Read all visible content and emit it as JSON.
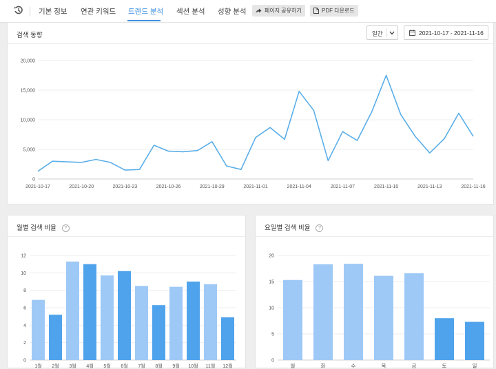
{
  "nav": {
    "tabs": [
      {
        "label": "기본 정보"
      },
      {
        "label": "연관 키워드"
      },
      {
        "label": "트렌드 분석"
      },
      {
        "label": "섹션 분석"
      },
      {
        "label": "성향 분석"
      }
    ],
    "share_label": "페이지 공유하기",
    "pdf_label": "PDF 다운로드",
    "history_icon": "history-icon",
    "accent_color": "#3d8fe0"
  },
  "trend": {
    "title": "검색 동향",
    "period_value": "일간",
    "date_range": "2021-10-17 - 2021-11-16"
  },
  "monthly": {
    "title": "월별 검색 비율"
  },
  "weekday": {
    "title": "요일별 검색 비율"
  },
  "chart_data": [
    {
      "type": "line",
      "x": [
        "2021-10-17",
        "2021-10-18",
        "2021-10-19",
        "2021-10-20",
        "2021-10-21",
        "2021-10-22",
        "2021-10-23",
        "2021-10-24",
        "2021-10-25",
        "2021-10-26",
        "2021-10-27",
        "2021-10-28",
        "2021-10-29",
        "2021-10-30",
        "2021-10-31",
        "2021-11-01",
        "2021-11-02",
        "2021-11-03",
        "2021-11-04",
        "2021-11-05",
        "2021-11-06",
        "2021-11-07",
        "2021-11-08",
        "2021-11-09",
        "2021-11-10",
        "2021-11-11",
        "2021-11-12",
        "2021-11-13",
        "2021-11-14",
        "2021-11-15",
        "2021-11-16"
      ],
      "x_ticks": [
        "2021-10-17",
        "2021-10-20",
        "2021-10-23",
        "2021-10-26",
        "2021-10-29",
        "2021-11-01",
        "2021-11-04",
        "2021-11-07",
        "2021-11-10",
        "2021-11-13",
        "2021-11-16"
      ],
      "values": [
        1300,
        3000,
        2900,
        2800,
        3300,
        2800,
        1500,
        1600,
        5700,
        4700,
        4600,
        4800,
        6300,
        2200,
        1600,
        7000,
        8700,
        6700,
        14800,
        11600,
        3100,
        8000,
        6500,
        11300,
        17500,
        10900,
        7200,
        4400,
        6800,
        11100,
        7200
      ],
      "ylim": [
        0,
        20000
      ],
      "yticks": [
        "0",
        "5,000",
        "10,000",
        "15,000",
        "20,000"
      ],
      "color": "#5aaee8",
      "grid": true
    },
    {
      "type": "bar",
      "categories": [
        "1월",
        "2월",
        "3월",
        "4월",
        "5월",
        "6월",
        "7월",
        "8월",
        "9월",
        "10월",
        "11월",
        "12월"
      ],
      "values": [
        6.9,
        5.2,
        11.3,
        11.0,
        9.7,
        10.2,
        8.5,
        6.3,
        8.4,
        9.0,
        8.7,
        4.9
      ],
      "highlight": [
        false,
        true,
        false,
        true,
        false,
        true,
        false,
        true,
        false,
        true,
        false,
        true
      ],
      "ylim": [
        0,
        12
      ],
      "yticks": [
        "0",
        "2",
        "4",
        "6",
        "8",
        "10",
        "12"
      ],
      "colors": {
        "light": "#9ec9f6",
        "dark": "#4fa3ec"
      }
    },
    {
      "type": "bar",
      "categories": [
        "월",
        "화",
        "수",
        "목",
        "금",
        "토",
        "일"
      ],
      "values": [
        15.3,
        18.3,
        18.4,
        16.1,
        16.6,
        8.0,
        7.3
      ],
      "highlight": [
        false,
        false,
        false,
        false,
        false,
        true,
        true
      ],
      "ylim": [
        0,
        20
      ],
      "yticks": [
        "0",
        "5",
        "10",
        "15",
        "20"
      ],
      "colors": {
        "light": "#9ec9f6",
        "dark": "#4fa3ec"
      }
    }
  ]
}
